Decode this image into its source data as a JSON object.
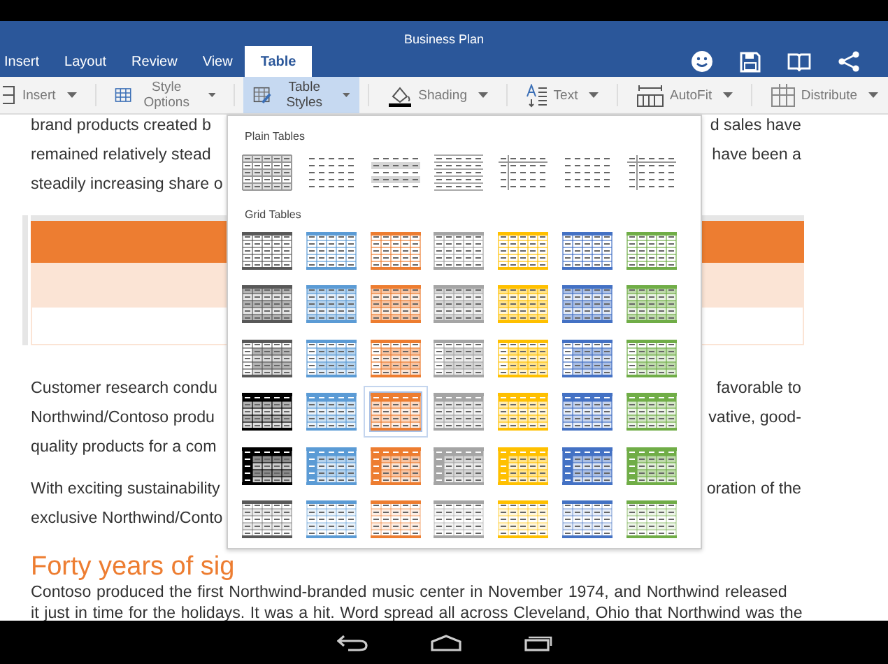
{
  "window": {
    "title": "Business Plan"
  },
  "tabs": [
    {
      "label": "Insert",
      "selected": false
    },
    {
      "label": "Layout",
      "selected": false
    },
    {
      "label": "Review",
      "selected": false
    },
    {
      "label": "View",
      "selected": false
    },
    {
      "label": "Table",
      "selected": true
    }
  ],
  "toolbar_icons": [
    {
      "kind": "smiley"
    },
    {
      "kind": "save"
    },
    {
      "kind": "book"
    },
    {
      "kind": "share"
    }
  ],
  "ribbon": [
    {
      "label": "Insert",
      "kind": "insert",
      "selected": false
    },
    {
      "label": "Style Options",
      "kind": "grid",
      "selected": false
    },
    {
      "label": "Table Styles",
      "kind": "styles",
      "selected": true
    },
    {
      "label": "Shading",
      "kind": "bucket",
      "selected": false
    },
    {
      "label": "Text",
      "kind": "text",
      "selected": false
    },
    {
      "label": "AutoFit",
      "kind": "autofit",
      "selected": false
    },
    {
      "label": "Distribute",
      "kind": "distribute",
      "selected": false
    }
  ],
  "document": {
    "lines_top": [
      {
        "left": "brand products created b",
        "right": "d sales have"
      },
      {
        "left": "remained relatively stead",
        "right": "have been a"
      },
      {
        "left": "steadily increasing share o"
      }
    ],
    "paragraph_2": [
      {
        "left": "Customer research condu",
        "right": "favorable to"
      },
      {
        "left": "Northwind/Contoso produ",
        "right": "vative, good-"
      },
      {
        "left": "quality products for a com"
      }
    ],
    "paragraph_3": [
      {
        "left": "With exciting sustainability",
        "right": "oration of the"
      },
      {
        "left": "exclusive Northwind/Conto"
      }
    ],
    "heading": "Forty years of sig",
    "paragraph_4": [
      "Contoso produced the first Northwind-branded music center in November 1974, and Northwind released",
      "it just in time for the holidays. It was a hit. Word spread all across Cleveland, Ohio that Northwind was the"
    ]
  },
  "gallery": {
    "sections": [
      {
        "title": "Plain Tables",
        "rows": [
          {
            "styles": [
              {
                "kind": "grid",
                "selected": false
              },
              {
                "kind": "plain",
                "selected": false
              },
              {
                "kind": "shaded",
                "selected": false
              },
              {
                "kind": "horizontal",
                "selected": false
              },
              {
                "kind": "first-column",
                "selected": false
              },
              {
                "kind": "plain",
                "selected": false
              },
              {
                "kind": "first-column",
                "selected": false
              }
            ]
          }
        ]
      },
      {
        "title": "Grid Tables",
        "rows": [
          {
            "kind": "light",
            "styles": [
              {
                "color": "#595959",
                "selected": false
              },
              {
                "color": "#5b9bd5",
                "selected": false
              },
              {
                "color": "#ed7d31",
                "selected": false
              },
              {
                "color": "#a5a5a5",
                "selected": false
              },
              {
                "color": "#ffc000",
                "selected": false
              },
              {
                "color": "#4472c4",
                "selected": false
              },
              {
                "color": "#70ad47",
                "selected": false
              }
            ]
          },
          {
            "kind": "shaded",
            "styles": [
              {
                "color": "#595959",
                "selected": false
              },
              {
                "color": "#5b9bd5",
                "selected": false
              },
              {
                "color": "#ed7d31",
                "selected": false
              },
              {
                "color": "#a5a5a5",
                "selected": false
              },
              {
                "color": "#ffc000",
                "selected": false
              },
              {
                "color": "#4472c4",
                "selected": false
              },
              {
                "color": "#70ad47",
                "selected": false
              }
            ]
          },
          {
            "kind": "column-shaded",
            "styles": [
              {
                "color": "#595959",
                "selected": false
              },
              {
                "color": "#5b9bd5",
                "selected": false
              },
              {
                "color": "#ed7d31",
                "selected": false
              },
              {
                "color": "#a5a5a5",
                "selected": false
              },
              {
                "color": "#ffc000",
                "selected": false
              },
              {
                "color": "#4472c4",
                "selected": false
              },
              {
                "color": "#70ad47",
                "selected": false
              }
            ]
          },
          {
            "kind": "header",
            "styles": [
              {
                "color": "#000000",
                "selected": false
              },
              {
                "color": "#5b9bd5",
                "selected": false
              },
              {
                "color": "#ed7d31",
                "selected": true
              },
              {
                "color": "#a5a5a5",
                "selected": false
              },
              {
                "color": "#ffc000",
                "selected": false
              },
              {
                "color": "#4472c4",
                "selected": false
              },
              {
                "color": "#70ad47",
                "selected": false
              }
            ]
          },
          {
            "kind": "header-column",
            "styles": [
              {
                "color": "#000000",
                "selected": false
              },
              {
                "color": "#5b9bd5",
                "selected": false
              },
              {
                "color": "#ed7d31",
                "selected": false
              },
              {
                "color": "#a5a5a5",
                "selected": false
              },
              {
                "color": "#ffc000",
                "selected": false
              },
              {
                "color": "#4472c4",
                "selected": false
              },
              {
                "color": "#70ad47",
                "selected": false
              }
            ]
          },
          {
            "kind": "faint",
            "styles": [
              {
                "color": "#595959",
                "selected": false
              },
              {
                "color": "#5b9bd5",
                "selected": false
              },
              {
                "color": "#ed7d31",
                "selected": false
              },
              {
                "color": "#a5a5a5",
                "selected": false
              },
              {
                "color": "#ffc000",
                "selected": false
              },
              {
                "color": "#4472c4",
                "selected": false
              },
              {
                "color": "#70ad47",
                "selected": false
              }
            ]
          }
        ]
      }
    ]
  },
  "nav_bar": [
    {
      "kind": "back"
    },
    {
      "kind": "home"
    },
    {
      "kind": "recents"
    }
  ]
}
